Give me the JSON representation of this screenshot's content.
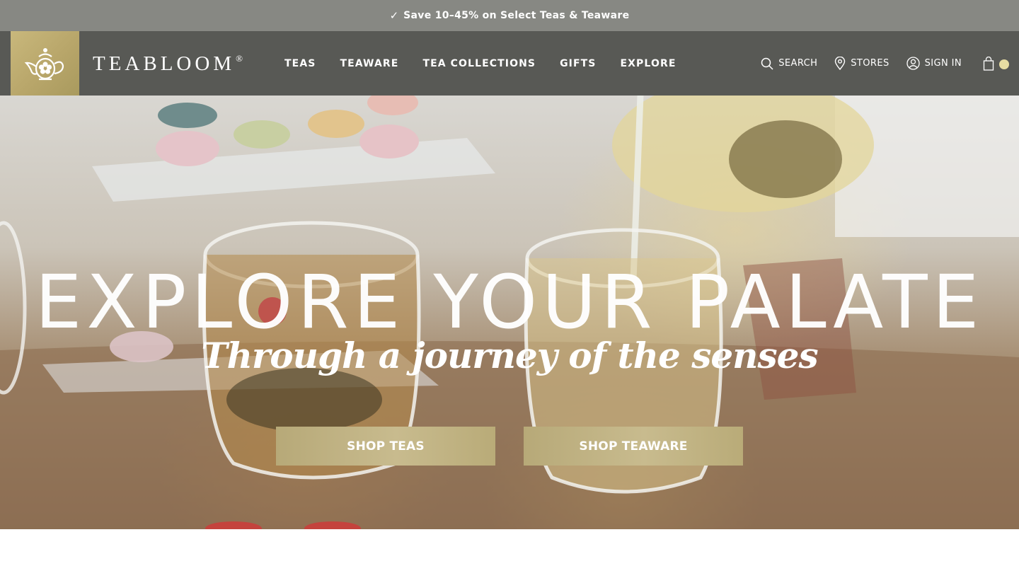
{
  "promo": {
    "check": "✓",
    "text": "Save 10–45% on Select Teas & Teaware"
  },
  "header": {
    "brand": "TEABLOOM",
    "brand_mark": "®",
    "nav": [
      "TEAS",
      "TEAWARE",
      "TEA COLLECTIONS",
      "GIFTS",
      "EXPLORE"
    ],
    "utils": {
      "search": "SEARCH",
      "stores": "STORES",
      "signin": "SIGN IN"
    },
    "cart_dot_color": "#e8dea3"
  },
  "hero": {
    "title": "EXPLORE YOUR PALATE",
    "subtitle": "Through a journey of the senses",
    "cta_primary": "SHOP TEAS",
    "cta_secondary": "SHOP TEAWARE"
  },
  "colors": {
    "gold": "#b8a66a",
    "header": "#585955",
    "promo": "#878883"
  }
}
